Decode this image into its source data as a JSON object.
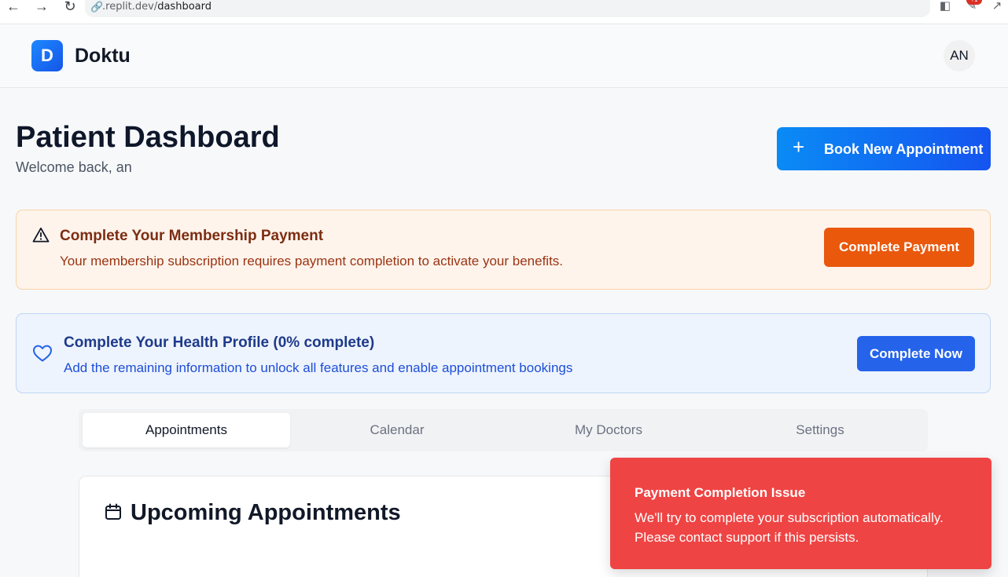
{
  "browser": {
    "url_prefix": ".replit.dev/",
    "url_path": "dashboard",
    "badge": "+1"
  },
  "header": {
    "logo_letter": "D",
    "app_name": "Doktu",
    "avatar_initials": "AN"
  },
  "page": {
    "title": "Patient Dashboard",
    "subtitle": "Welcome back, an",
    "book_button": "Book New Appointment"
  },
  "alerts": {
    "payment": {
      "title": "Complete Your Membership Payment",
      "description": "Your membership subscription requires payment completion to activate your benefits.",
      "button": "Complete Payment"
    },
    "profile": {
      "title": "Complete Your Health Profile (0% complete)",
      "description": "Add the remaining information to unlock all features and enable appointment bookings",
      "button": "Complete Now",
      "completion_percent": 0
    }
  },
  "tabs": [
    {
      "label": "Appointments",
      "active": true
    },
    {
      "label": "Calendar",
      "active": false
    },
    {
      "label": "My Doctors",
      "active": false
    },
    {
      "label": "Settings",
      "active": false
    }
  ],
  "card": {
    "title": "Upcoming Appointments"
  },
  "toast": {
    "title": "Payment Completion Issue",
    "message": "We'll try to complete your subscription automatically. Please contact support if this persists."
  },
  "colors": {
    "primary": "#2563eb",
    "warning": "#ea580c",
    "toast": "#ef4444"
  },
  "icons": [
    "back-arrow-icon",
    "forward-arrow-icon",
    "reload-icon",
    "link-icon",
    "cast-icon",
    "extension-icon",
    "open-external-icon",
    "plus-icon",
    "warning-triangle-icon",
    "heart-icon",
    "calendar-icon"
  ]
}
